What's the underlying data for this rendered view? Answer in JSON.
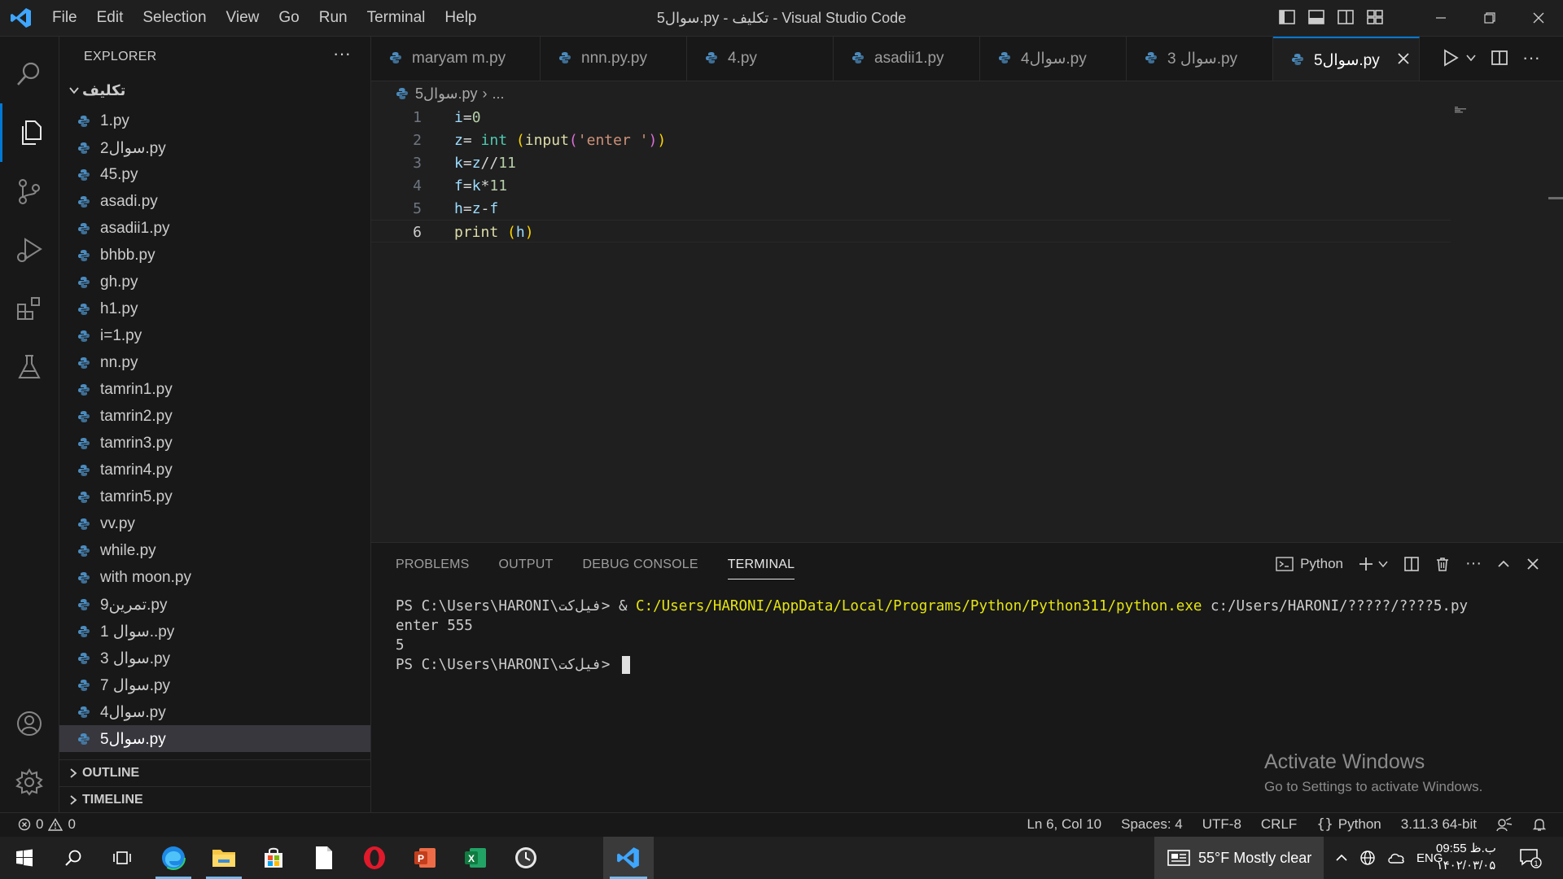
{
  "window": {
    "title": "5سوال.py - تکلیف - Visual Studio Code",
    "menu": [
      "File",
      "Edit",
      "Selection",
      "View",
      "Go",
      "Run",
      "Terminal",
      "Help"
    ]
  },
  "explorer": {
    "header": "EXPLORER",
    "more": "···",
    "folder": "تکلیف",
    "files": [
      "1.py",
      "2سوال.py",
      "45.py",
      "asadi.py",
      "asadii1.py",
      "bhbb.py",
      "gh.py",
      "h1.py",
      "i=1.py",
      "nn.py",
      "tamrin1.py",
      "tamrin2.py",
      "tamrin3.py",
      "tamrin4.py",
      "tamrin5.py",
      "vv.py",
      "while.py",
      "with moon.py",
      "9تمرین.py",
      "1 سوال..py",
      "3 سوال.py",
      "7 سوال.py",
      "4سوال.py",
      "5سوال.py"
    ],
    "selected_file": "5سوال.py",
    "sections": [
      "OUTLINE",
      "TIMELINE"
    ]
  },
  "tabs": [
    "maryam m.py",
    "nnn.py.py",
    "4.py",
    "asadii1.py",
    "4سوال.py",
    "3 سوال.py",
    "5سوال.py"
  ],
  "active_tab": "5سوال.py",
  "breadcrumb": {
    "file": "5سوال.py",
    "separator": "›",
    "rest": "..."
  },
  "editor": {
    "current_line": 6,
    "lines": [
      {
        "n": "1",
        "text": "i=0"
      },
      {
        "n": "2",
        "text": "z= int (input('enter '))"
      },
      {
        "n": "3",
        "text": "k=z//11"
      },
      {
        "n": "4",
        "text": "f=k*11"
      },
      {
        "n": "5",
        "text": "h=z-f"
      },
      {
        "n": "6",
        "text": "print (h)"
      }
    ]
  },
  "panel": {
    "tabs": [
      "PROBLEMS",
      "OUTPUT",
      "DEBUG CONSOLE",
      "TERMINAL"
    ],
    "active_tab": "TERMINAL",
    "shell": "Python",
    "terminal": {
      "prompt": "PS C:\\Users\\HARONI\\فیل‌کت> ",
      "command_amp": "& ",
      "command_exe": "C:/Users/HARONI/AppData/Local/Programs/Python/Python311/python.exe",
      "command_arg": " c:/Users/HARONI/?????/????5.py",
      "output1": "enter 555",
      "output2": "5",
      "prompt2": "PS C:\\Users\\HARONI\\فیل‌کت> "
    }
  },
  "watermark": {
    "title": "Activate Windows",
    "subtitle": "Go to Settings to activate Windows."
  },
  "statusbar": {
    "errors": "0",
    "warnings": "0",
    "position": "Ln 6, Col 10",
    "spaces": "Spaces: 4",
    "encoding": "UTF-8",
    "eol": "CRLF",
    "language": "Python",
    "interpreter": "3.11.3 64-bit"
  },
  "taskbar": {
    "weather": "55°F  Mostly clear",
    "lang": "ENG",
    "time": "09:55 ب.ظ",
    "date": "۱۴۰۲/۰۳/۰۵",
    "notif_count": "1"
  },
  "colors": {
    "accent": "#0078d4",
    "python_icon": "#4b8bbe",
    "terminal_highlight": "#e5e510"
  }
}
